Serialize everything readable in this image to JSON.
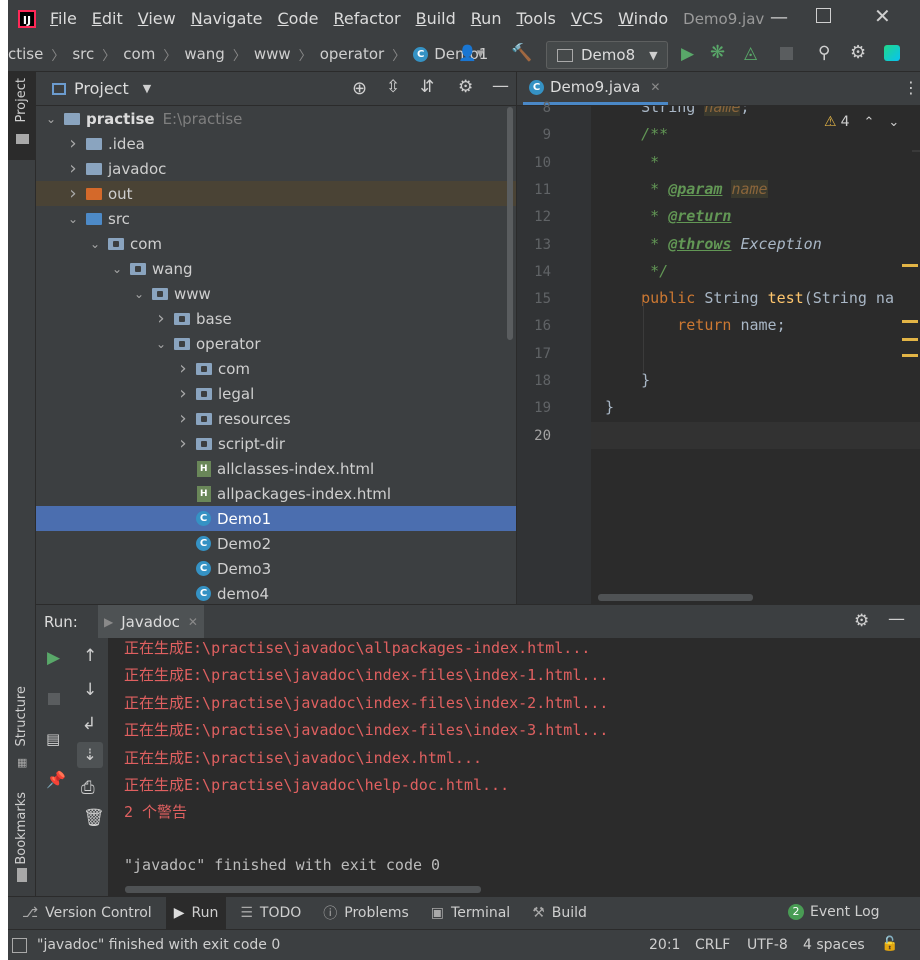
{
  "titlebar": {
    "menus": [
      {
        "label": "File",
        "mn": "F",
        "rest": "ile"
      },
      {
        "label": "Edit",
        "mn": "E",
        "rest": "dit"
      },
      {
        "label": "View",
        "mn": "V",
        "rest": "iew"
      },
      {
        "label": "Navigate",
        "mn": "N",
        "rest": "avigate"
      },
      {
        "label": "Code",
        "mn": "C",
        "rest": "ode"
      },
      {
        "label": "Refactor",
        "mn": "R",
        "rest": "efactor"
      },
      {
        "label": "Build",
        "mn": "B",
        "rest": "uild"
      },
      {
        "label": "Run",
        "mn": "R",
        "rest": "un"
      },
      {
        "label": "Tools",
        "mn": "T",
        "rest": "ools"
      },
      {
        "label": "VCS",
        "mn": "V",
        "rest": "CS"
      },
      {
        "label": "Windo",
        "mn": "W",
        "rest": "indo"
      }
    ],
    "title": "Demo9.jav"
  },
  "breadcrumb": [
    "ctise",
    "src",
    "com",
    "wang",
    "www",
    "operator",
    "Demo1"
  ],
  "run_config": "Demo8",
  "project_panel": {
    "title": "Project",
    "root_name": "practise",
    "root_path": "E:\\practise",
    "items": [
      {
        "label": ".idea",
        "depth": 1,
        "kind": "folder",
        "expanded": false
      },
      {
        "label": "javadoc",
        "depth": 1,
        "kind": "folder",
        "expanded": false
      },
      {
        "label": "out",
        "depth": 1,
        "kind": "folder-orange",
        "expanded": false
      },
      {
        "label": "src",
        "depth": 1,
        "kind": "folder-blue",
        "expanded": true
      },
      {
        "label": "com",
        "depth": 2,
        "kind": "package",
        "expanded": true
      },
      {
        "label": "wang",
        "depth": 3,
        "kind": "package",
        "expanded": true
      },
      {
        "label": "www",
        "depth": 4,
        "kind": "package",
        "expanded": true
      },
      {
        "label": "base",
        "depth": 5,
        "kind": "package",
        "expanded": false
      },
      {
        "label": "operator",
        "depth": 5,
        "kind": "package",
        "expanded": true
      },
      {
        "label": "com",
        "depth": 6,
        "kind": "package",
        "expanded": false
      },
      {
        "label": "legal",
        "depth": 6,
        "kind": "package",
        "expanded": false
      },
      {
        "label": "resources",
        "depth": 6,
        "kind": "package",
        "expanded": false
      },
      {
        "label": "script-dir",
        "depth": 6,
        "kind": "package",
        "expanded": false
      },
      {
        "label": "allclasses-index.html",
        "depth": 6,
        "kind": "html"
      },
      {
        "label": "allpackages-index.html",
        "depth": 6,
        "kind": "html"
      },
      {
        "label": "Demo1",
        "depth": 6,
        "kind": "class",
        "selected": true
      },
      {
        "label": "Demo2",
        "depth": 6,
        "kind": "class"
      },
      {
        "label": "Demo3",
        "depth": 6,
        "kind": "class"
      },
      {
        "label": "demo4",
        "depth": 6,
        "kind": "class"
      }
    ]
  },
  "editor": {
    "tab": "Demo9.java",
    "warning_count": "4",
    "lines": [
      {
        "n": "8",
        "parts": [
          [
            "",
            "    String "
          ],
          [
            "pname",
            "name"
          ],
          [
            "",
            ";"
          ]
        ]
      },
      {
        "n": "9",
        "parts": [
          [
            "doc",
            "    /**"
          ]
        ]
      },
      {
        "n": "10",
        "parts": [
          [
            "doc",
            "     *"
          ]
        ]
      },
      {
        "n": "11",
        "parts": [
          [
            "doc",
            "     * "
          ],
          [
            "tag",
            "@param"
          ],
          [
            "doc",
            " "
          ],
          [
            "pname",
            "name"
          ]
        ]
      },
      {
        "n": "12",
        "parts": [
          [
            "doc",
            "     * "
          ],
          [
            "tag",
            "@return"
          ]
        ]
      },
      {
        "n": "13",
        "parts": [
          [
            "doc",
            "     * "
          ],
          [
            "tag",
            "@throws"
          ],
          [
            "ex",
            " Exception"
          ]
        ]
      },
      {
        "n": "14",
        "parts": [
          [
            "doc",
            "     */"
          ]
        ]
      },
      {
        "n": "15",
        "parts": [
          [
            "kw",
            "    public "
          ],
          [
            "",
            "String "
          ],
          [
            "fn",
            "test"
          ],
          [
            "",
            "(String na"
          ]
        ]
      },
      {
        "n": "16",
        "parts": [
          [
            "kw",
            "        return "
          ],
          [
            "",
            "name;"
          ]
        ]
      },
      {
        "n": "17",
        "parts": [
          [
            "",
            ""
          ]
        ]
      },
      {
        "n": "18",
        "parts": [
          [
            "",
            "    }"
          ]
        ]
      },
      {
        "n": "19",
        "parts": [
          [
            "",
            "}"
          ]
        ]
      },
      {
        "n": "20",
        "parts": [
          [
            "",
            ""
          ]
        ]
      }
    ]
  },
  "run_panel": {
    "label": "Run:",
    "tab": "Javadoc",
    "output": [
      "正在生成E:\\practise\\javadoc\\allpackages-index.html...",
      "正在生成E:\\practise\\javadoc\\index-files\\index-1.html...",
      "正在生成E:\\practise\\javadoc\\index-files\\index-2.html...",
      "正在生成E:\\practise\\javadoc\\index-files\\index-3.html...",
      "正在生成E:\\practise\\javadoc\\index.html...",
      "正在生成E:\\practise\\javadoc\\help-doc.html...",
      "2 个警告"
    ],
    "finished": "\"javadoc\" finished with exit code 0"
  },
  "left_strip": {
    "project": "Project",
    "structure": "Structure",
    "bookmarks": "Bookmarks"
  },
  "bottom_tabs": [
    "Version Control",
    "Run",
    "TODO",
    "Problems",
    "Terminal",
    "Build"
  ],
  "event_log": {
    "count": "2",
    "label": "Event Log"
  },
  "status": {
    "message": "\"javadoc\" finished with exit code 0",
    "position": "20:1",
    "line_sep": "CRLF",
    "encoding": "UTF-8",
    "indent": "4 spaces"
  }
}
